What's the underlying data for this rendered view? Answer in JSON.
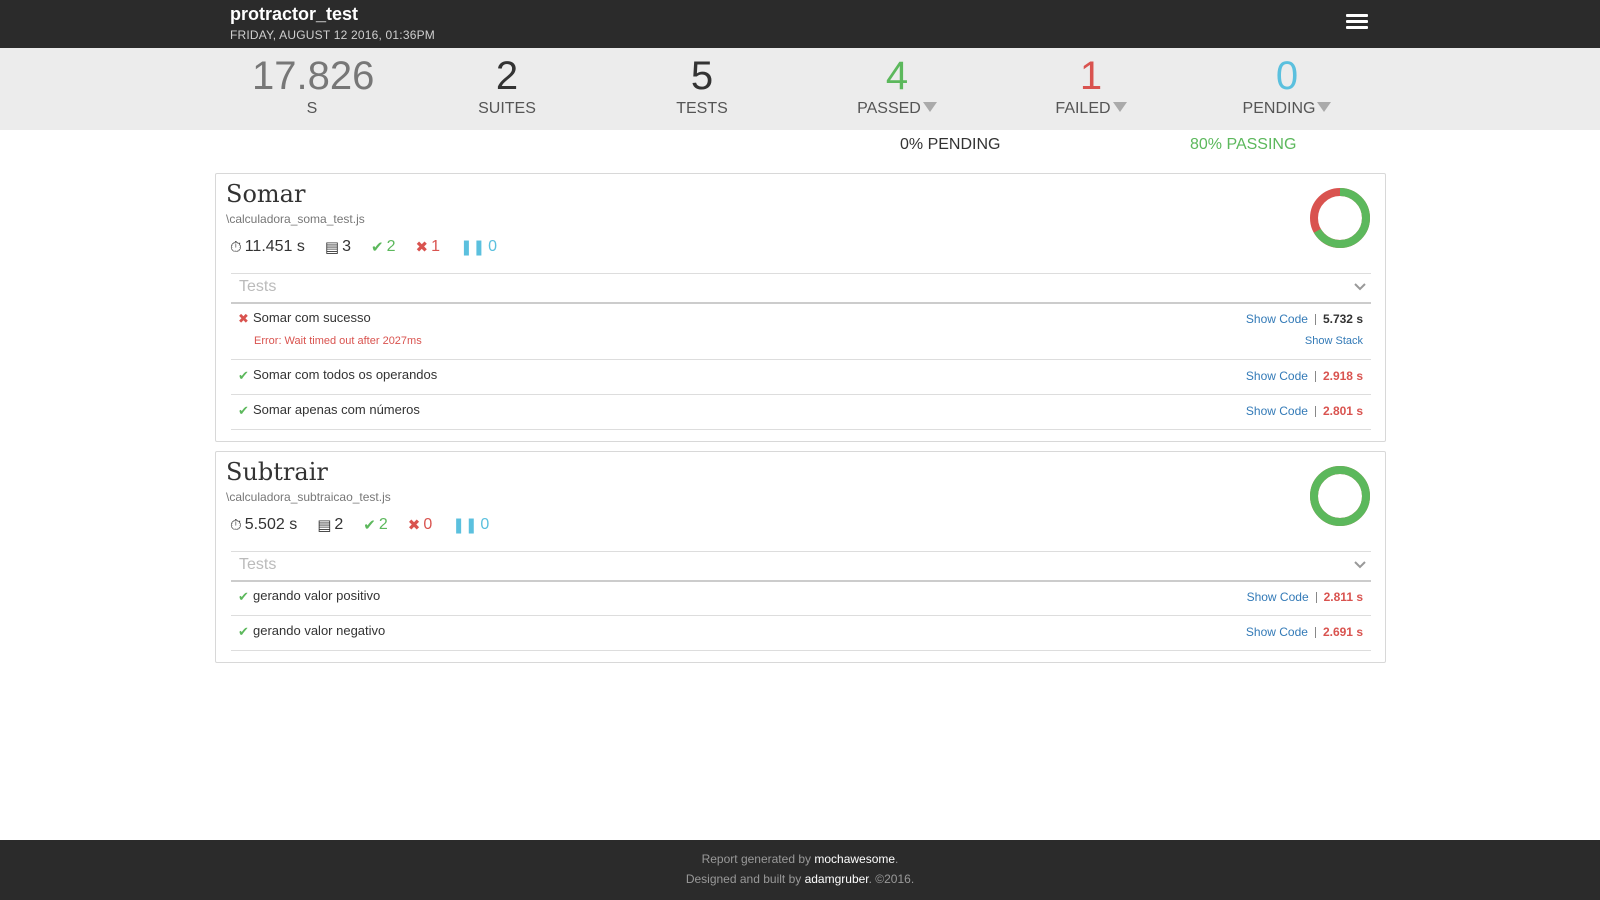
{
  "header": {
    "title": "protractor_test",
    "date": "FRIDAY, AUGUST 12 2016, 01:36PM"
  },
  "summary": {
    "duration": "17.826",
    "duration_unit": "S",
    "suites": "2",
    "suites_label": "SUITES",
    "tests": "5",
    "tests_label": "TESTS",
    "passed": "4",
    "passed_label": "PASSED",
    "failed": "1",
    "failed_label": "FAILED",
    "pending": "0",
    "pending_label": "PENDING",
    "pending_pct": "0% PENDING",
    "passing_pct": "80% PASSING"
  },
  "colors": {
    "pass": "#5cb85c",
    "fail": "#d9534f",
    "pending": "#5bc0de",
    "header_bg": "#2b2b2b"
  },
  "suites": [
    {
      "title": "Somar",
      "file": "\\calculadora_soma_test.js",
      "duration": "11.451 s",
      "tests": "3",
      "passes": "2",
      "failures": "1",
      "pending": "0",
      "pass_fraction": 0.667,
      "tests_label": "Tests",
      "items": [
        {
          "name": "Somar com sucesso",
          "state": "failed",
          "error": "Error: Wait timed out after 2027ms",
          "show_code": "Show Code",
          "show_stack": "Show Stack",
          "duration": "5.732 s"
        },
        {
          "name": "Somar com todos os operandos",
          "state": "passed",
          "show_code": "Show Code",
          "duration": "2.918 s"
        },
        {
          "name": "Somar apenas com números",
          "state": "passed",
          "show_code": "Show Code",
          "duration": "2.801 s"
        }
      ]
    },
    {
      "title": "Subtrair",
      "file": "\\calculadora_subtraicao_test.js",
      "duration": "5.502 s",
      "tests": "2",
      "passes": "2",
      "failures": "0",
      "pending": "0",
      "pass_fraction": 1.0,
      "tests_label": "Tests",
      "items": [
        {
          "name": "gerando valor positivo",
          "state": "passed",
          "show_code": "Show Code",
          "duration": "2.811 s"
        },
        {
          "name": "gerando valor negativo",
          "state": "passed",
          "show_code": "Show Code",
          "duration": "2.691 s"
        }
      ]
    }
  ],
  "footer": {
    "line1_prefix": "Report generated by ",
    "line1_link": "mochawesome",
    "line1_suffix": ".",
    "line2_prefix": "Designed and built by ",
    "line2_link": "adamgruber",
    "line2_suffix": ". ©2016."
  }
}
